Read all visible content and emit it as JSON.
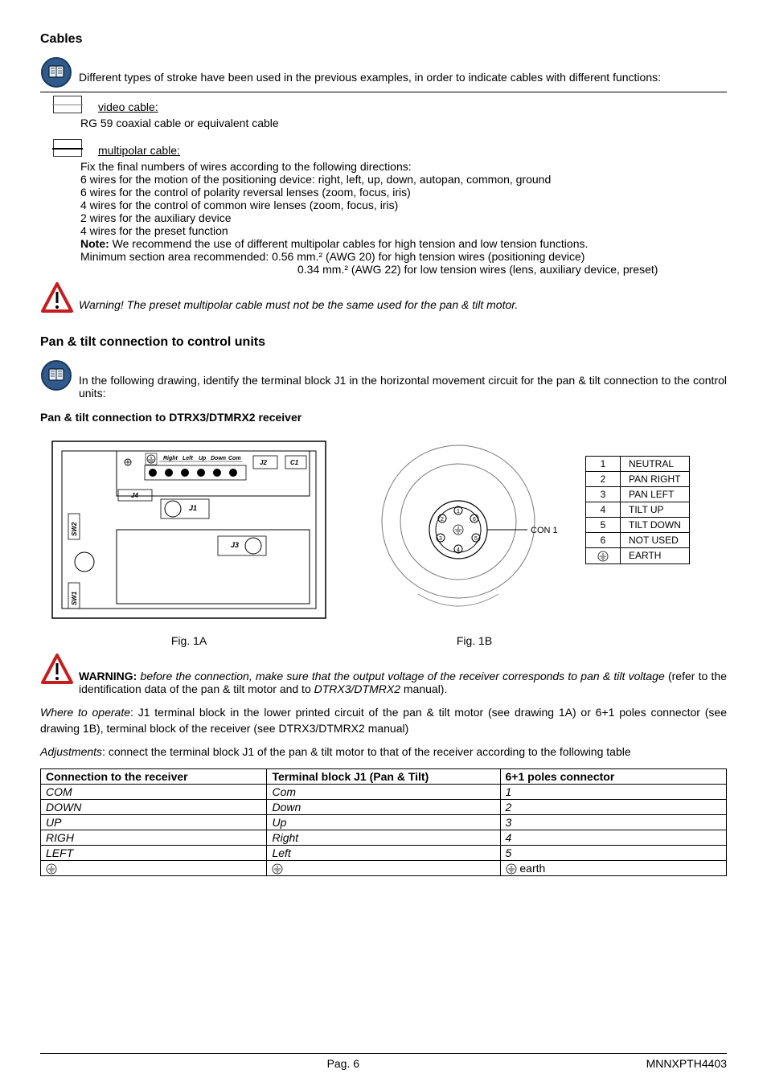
{
  "headings": {
    "cables": "Cables",
    "pantilt": "Pan & tilt connection to control units",
    "pantilt_sub": "Pan & tilt connection to DTRX3/DTMRX2 receiver"
  },
  "cables": {
    "intro": "Different types of stroke have been used in the previous examples, in order to indicate cables with different functions:",
    "video_label": "video cable:",
    "video_desc": "RG 59 coaxial cable or equivalent cable",
    "multi_label": "multipolar cable:",
    "multi_lines": [
      "Fix the final numbers of wires according to the following directions:",
      "6 wires for the motion of the positioning device: right, left, up, down, autopan, common, ground",
      "6 wires for the control of polarity reversal lenses (zoom, focus, iris)",
      "4 wires for the control of common wire lenses (zoom, focus, iris)",
      "2 wires for the auxiliary device",
      "4 wires for the preset function"
    ],
    "note_prefix": "Note:",
    "note_text": " We recommend the use of different multipolar cables for high tension and low tension functions.",
    "min_section": "Minimum section area recommended:   0.56 mm.²  (AWG 20) for high tension wires (positioning device)",
    "min_section2": "0.34 mm.²  (AWG 22) for low tension wires (lens, auxiliary device, preset)",
    "warn1": "Warning! The preset multipolar cable must not be the same used for the pan & tilt motor"
  },
  "pantilt": {
    "intro": "In the following drawing, identify the terminal block J1 in the horizontal movement circuit for the pan & tilt connection to the control units:",
    "fig1a": "Fig. 1A",
    "fig1b": "Fig. 1B",
    "warn2_prefix": "WARNING:",
    "warn2_italic": " before the connection, make sure that the output voltage of the receiver corresponds to pan & tilt voltage",
    "warn2_rest": " (refer to the identification data of the pan & tilt motor and to ",
    "warn2_manual": "DTRX3/DTMRX2",
    "warn2_end": " manual).",
    "where_prefix": "Where to operate",
    "where_text": ": J1 terminal block in the lower printed circuit of the pan & tilt motor (see drawing 1A) or 6+1 poles connector (see drawing 1B), terminal block of the receiver (see DTRX3/DTMRX2 manual)",
    "adjust_prefix": "Adjustments",
    "adjust_text": ": connect the terminal block J1 of the pan & tilt motor to that of the receiver according to the following table",
    "legend": [
      {
        "n": "1",
        "label": "NEUTRAL"
      },
      {
        "n": "2",
        "label": "PAN RIGHT"
      },
      {
        "n": "3",
        "label": "PAN LEFT"
      },
      {
        "n": "4",
        "label": "TILT UP"
      },
      {
        "n": "5",
        "label": "TILT DOWN"
      },
      {
        "n": "6",
        "label": "NOT USED"
      },
      {
        "n": "",
        "label": "EARTH"
      }
    ],
    "con1": "CON 1"
  },
  "table": {
    "headers": [
      "Connection to the receiver",
      "Terminal block J1 (Pan & Tilt)",
      "6+1 poles connector"
    ],
    "rows": [
      [
        "COM",
        "Com",
        "1"
      ],
      [
        "DOWN",
        "Down",
        "2"
      ],
      [
        "UP",
        "Up",
        "3"
      ],
      [
        "RIGH",
        "Right",
        "4"
      ],
      [
        "LEFT",
        "Left",
        "5"
      ]
    ],
    "earth_row": [
      "",
      "",
      " earth"
    ]
  },
  "diagram1a": {
    "row_labels": [
      "Right",
      "Left",
      "Up",
      "Down",
      "Com"
    ],
    "J1": "J1",
    "J2": "J2",
    "J3": "J3",
    "J4": "J4",
    "C1": "C1",
    "SW1": "SW1",
    "SW2": "SW2"
  },
  "footer": {
    "page": "Pag. 6",
    "code": "MNNXPTH4403"
  }
}
